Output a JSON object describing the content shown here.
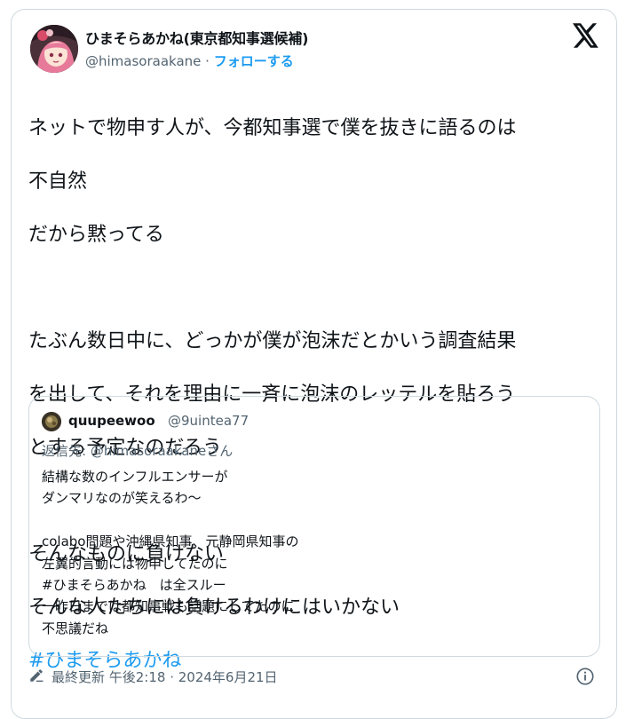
{
  "author": {
    "name": "ひまそらあかね(東京都知事選候補)",
    "handle": "@himasoraakane",
    "separator": " · ",
    "follow_label": "フォローする"
  },
  "tweet": {
    "lines": [
      "ネットで物申す人が、今都知事選で僕を抜きに語るのは",
      "不自然",
      "だから黙ってる",
      "",
      "たぶん数日中に、どっかが僕が泡沫だとかいう調査結果",
      "を出して、それを理由に一斉に泡沫のレッテルを貼ろう",
      "とする予定なのだろう",
      "",
      "そんなものに負けない",
      "そんな人たちには負けるわけにはいかない"
    ],
    "hashtag": "#ひまそらあかね"
  },
  "quote": {
    "name": "quupeewoo",
    "handle": "@9uintea77",
    "reply_prefix": "返信先: ",
    "reply_mention": "@himasoraakane",
    "reply_suffix": "さん",
    "lines": [
      "結構な数のインフルエンサーが",
      "ダンマリなのが笑えるわ〜",
      "",
      "colabo問題や沖縄県知事、元静岡県知事の",
      "左翼的言動には物申してたのに",
      "#ひまそらあかね　は全スルー",
      "一昨日までは都知事戦も話題にしてたのに",
      "不思議だね"
    ]
  },
  "footer": {
    "text": "最終更新 午後2:18 · 2024年6月21日"
  },
  "colors": {
    "accent": "#1d9bf0",
    "secondary_text": "#536471",
    "border": "#cfd9de"
  },
  "icons": [
    "x-logo-icon",
    "edit-pencil-icon",
    "info-icon"
  ]
}
